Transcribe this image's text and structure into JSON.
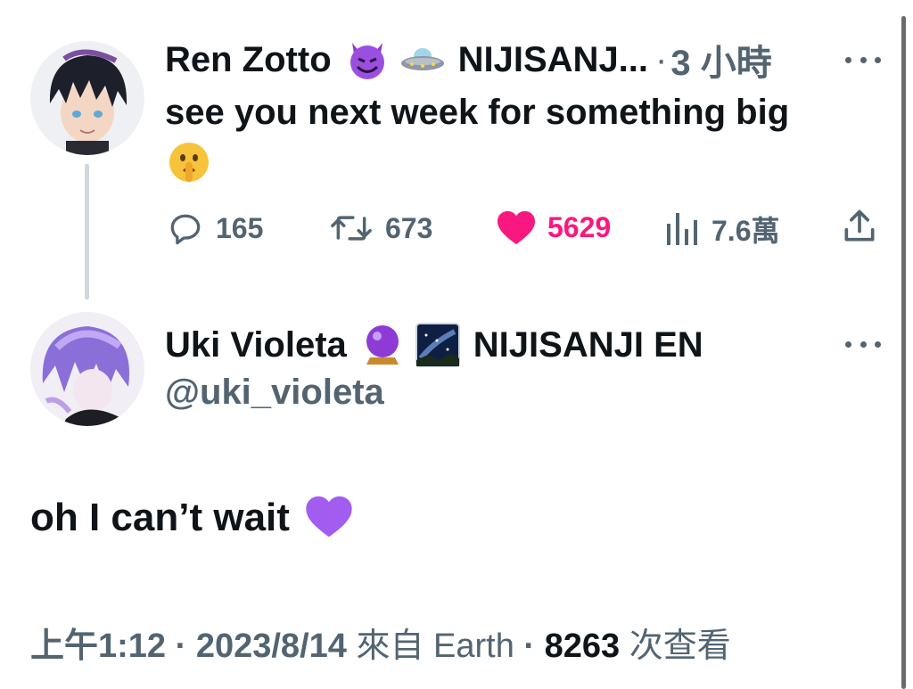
{
  "parent_tweet": {
    "author_name": "Ren Zotto",
    "author_emoji_1": "smiling-imp-emoji",
    "author_emoji_2": "flying-saucer-emoji",
    "affiliation": "NIJISANJ...",
    "separator": "·",
    "time_ago": "3 小時",
    "text": "see you next week for something big",
    "trailing_emoji": "shushing-face-emoji",
    "stats": {
      "replies": "165",
      "retweets": "673",
      "likes": "5629",
      "views": "7.6萬"
    },
    "like_color": "#f91880"
  },
  "reply_tweet": {
    "author_name": "Uki Violeta",
    "author_emoji_1": "crystal-ball-emoji",
    "author_emoji_2": "milky-way-emoji",
    "affiliation": "NIJISANJI EN",
    "handle": "@uki_violeta",
    "text": "oh I can’t wait",
    "trailing_emoji": "purple-heart-emoji",
    "meta": {
      "time": "上午1:12",
      "sep1": "·",
      "date": "2023/8/14",
      "source": "來自 Earth",
      "sep2": "·",
      "views_count": "8263",
      "views_label": "次查看"
    }
  },
  "colors": {
    "text_primary": "#0f1419",
    "text_secondary": "#536471",
    "thread_line": "#cfd9de",
    "accent_like": "#f91880"
  }
}
